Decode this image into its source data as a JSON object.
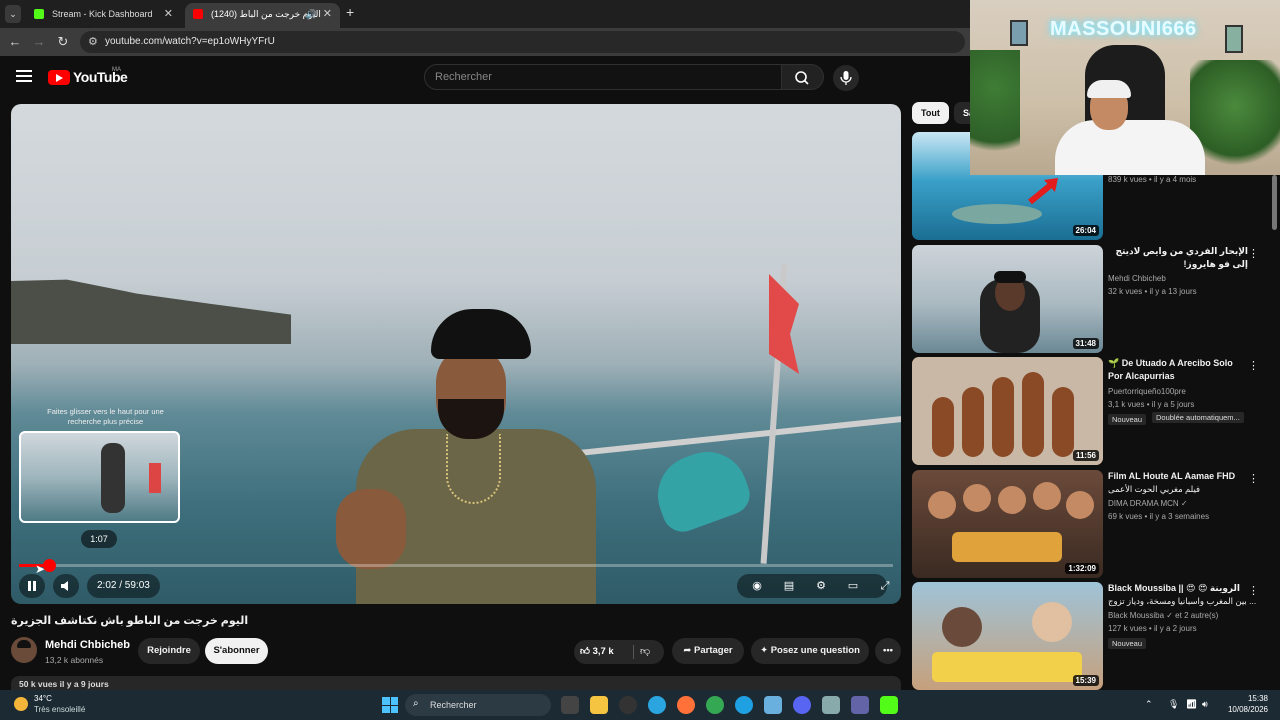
{
  "browser": {
    "tabs": [
      {
        "title": "Stream - Kick Dashboard",
        "favicon_color": "#53fc18"
      },
      {
        "title": "اليوم خرجت من الباط (1240)",
        "favicon_color": "#ff0000"
      }
    ],
    "url": "youtube.com/watch?v=ep1oWHyYFrU"
  },
  "youtube": {
    "logo_text": "YouTube",
    "country_code": "MA",
    "search_placeholder": "Rechercher"
  },
  "player": {
    "seek_hint": "Faites glisser vers le haut pour une recherche plus précise",
    "preview_time": "1:07",
    "current_time": "2:02 / 59:03",
    "progress_fraction": 0.034
  },
  "video": {
    "title": "اليوم خرجت من الباطو باش نكتاشف الجزيرة",
    "channel_name": "Mehdi Chbicheb",
    "subscribers": "13,2 k abonnés",
    "join_label": "Rejoindre",
    "subscribe_label": "S'abonner",
    "likes": "3,7 k",
    "share_label": "Partager",
    "ask_label": "Posez une question",
    "desc_peek": "50 k vues  il y a 9 jours"
  },
  "chips": [
    "Tout",
    "Sa"
  ],
  "recommendations": [
    {
      "title": "",
      "channel": "",
      "meta": "839 k vues • il y a 4 mois",
      "duration": "26:04"
    },
    {
      "title": "الإبحار الفردي من وايص لاديتج إلى فو هايروز!",
      "channel": "Mehdi Chbicheb",
      "meta": "32 k vues • il y a 13 jours",
      "duration": "31:48"
    },
    {
      "title": "🌱 De Utuado A Arecibo Solo Por Alcapurrias",
      "channel": "Puertorriqueño100pre",
      "meta": "3,1 k vues • il y a 5 jours",
      "badge": "Nouveau",
      "badge2": "Doublée automatiquem...",
      "duration": "11:56"
    },
    {
      "title": "Film AL Houte AL Aamae FHD",
      "subtitle": "فيلم مغربي الحوت الأعمى",
      "channel": "DIMA DRAMA MCN ✓",
      "meta": "69 k vues • il y a 3 semaines",
      "duration": "1:32:09"
    },
    {
      "title": "Black Moussiba || 😍 😍 الروينة",
      "subtitle": "بين المغرب واسبانيا ومسخة، ودياز تزوج ...",
      "channel": "Black Moussiba ✓ et 2 autre(s)",
      "meta": "127 k vues • il y a 2 jours",
      "badge": "Nouveau",
      "duration": "15:39"
    }
  ],
  "webcam": {
    "neon_text": "MASSOUNI666"
  },
  "taskbar": {
    "temperature": "34°C",
    "condition": "Très ensoleillé",
    "search_label": "Rechercher",
    "time": "15:38",
    "date": "10/08/2026"
  }
}
